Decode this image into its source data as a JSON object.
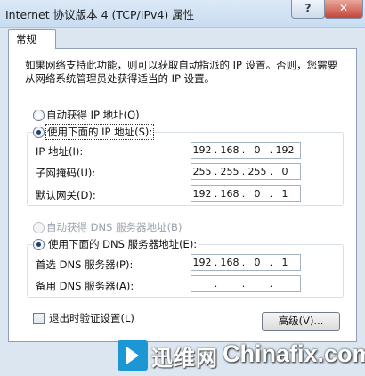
{
  "window": {
    "title": "Internet 协议版本 4 (TCP/IPv4) 属性",
    "help_label": "?",
    "close_label": "✕"
  },
  "tabs": [
    {
      "label": "常规"
    }
  ],
  "intro_text": "如果网络支持此功能，则可以获取自动指派的 IP 设置。否则，您需要从网络系统管理员处获得适当的 IP 设置。",
  "ip_section": {
    "auto_label": "自动获得 IP 地址(O)",
    "manual_label": "使用下面的 IP 地址(S):",
    "selected": "manual",
    "fields": [
      {
        "label": "IP 地址(I):",
        "octets": [
          "192",
          "168",
          "0",
          "192"
        ]
      },
      {
        "label": "子网掩码(U):",
        "octets": [
          "255",
          "255",
          "255",
          "0"
        ]
      },
      {
        "label": "默认网关(D):",
        "octets": [
          "192",
          "168",
          "0",
          "1"
        ]
      }
    ]
  },
  "dns_section": {
    "auto_label": "自动获得 DNS 服务器地址(B)",
    "manual_label": "使用下面的 DNS 服务器地址(E):",
    "selected": "manual",
    "fields": [
      {
        "label": "首选 DNS 服务器(P):",
        "octets": [
          "192",
          "168",
          "0",
          "1"
        ]
      },
      {
        "label": "备用 DNS 服务器(A):",
        "octets": [
          "",
          "",
          "",
          ""
        ]
      }
    ]
  },
  "validate_label": "退出时验证设置(L)",
  "validate_checked": false,
  "advanced_label": "高级(V)...",
  "watermark": {
    "cn": "迅维网",
    "en": "Chinafix.com"
  }
}
